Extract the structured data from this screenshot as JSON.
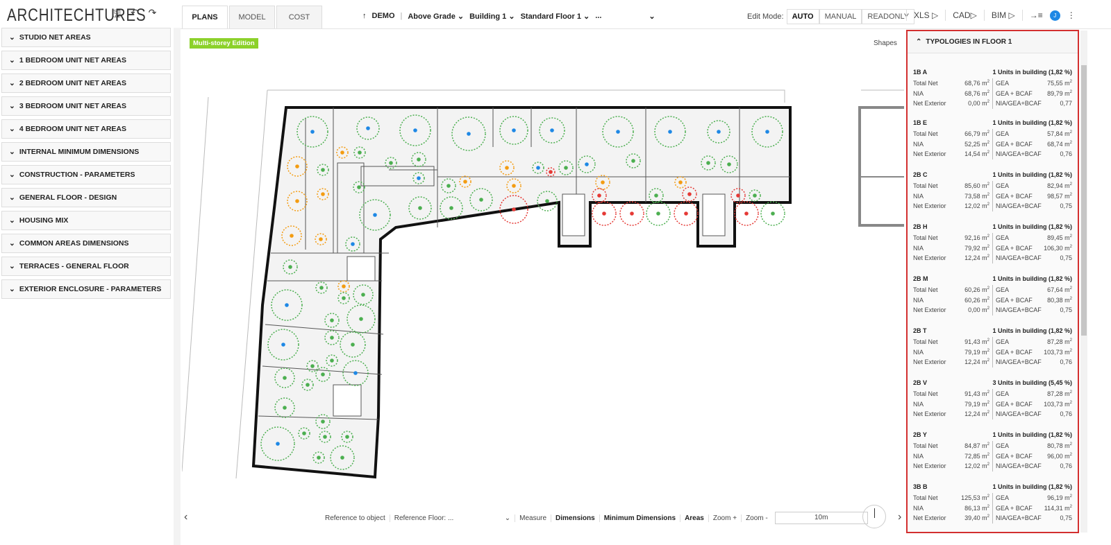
{
  "app": {
    "logo": "ARCHITECHTURES",
    "save_icon": "floppy-icon",
    "undo_icon": "undo-icon",
    "redo_icon": "redo-icon"
  },
  "tabs": [
    {
      "label": "PLANS",
      "active": true
    },
    {
      "label": "MODEL"
    },
    {
      "label": "COST"
    }
  ],
  "breadcrumb": {
    "project": "DEMO",
    "grade": "Above Grade",
    "building": "Building 1",
    "floor": "Standard Floor 1",
    "more": "..."
  },
  "edit_mode": {
    "label": "Edit Mode:",
    "options": [
      "AUTO",
      "MANUAL",
      "READONLY"
    ],
    "selected": "AUTO"
  },
  "exports": [
    "XLS ▷",
    "CAD▷",
    "BIM ▷"
  ],
  "user_initial": "J",
  "sidebar": [
    "STUDIO NET AREAS",
    "1 BEDROOM UNIT NET AREAS",
    "2 BEDROOM UNIT NET AREAS",
    "3 BEDROOM UNIT NET AREAS",
    "4 BEDROOM UNIT NET AREAS",
    "INTERNAL MINIMUM DIMENSIONS",
    "CONSTRUCTION - PARAMETERS",
    "GENERAL FLOOR - DESIGN",
    "HOUSING MIX",
    "COMMON AREAS DIMENSIONS",
    "TERRACES - GENERAL FLOOR",
    "EXTERIOR ENCLOSURE - PARAMETERS"
  ],
  "canvas": {
    "badge": "Multi-storey Edition",
    "shapes_label": "Shapes"
  },
  "panel": {
    "title": "TYPOLOGIES IN FLOOR 1",
    "labels": {
      "total_net": "Total Net",
      "nia": "NIA",
      "net_exterior": "Net Exterior",
      "gea": "GEA",
      "gea_bcaf": "GEA + BCAF",
      "ratio": "NIA/GEA+BCAF",
      "unit": "m"
    },
    "typologies": [
      {
        "name": "1B A",
        "units": "1 Units in building (1,82 %)",
        "total_net": "68,76",
        "nia": "68,76",
        "net_exterior": "0,00",
        "gea": "75,55",
        "gea_bcaf": "89,79",
        "ratio": "0,77"
      },
      {
        "name": "1B E",
        "units": "1 Units in building (1,82 %)",
        "total_net": "66,79",
        "nia": "52,25",
        "net_exterior": "14,54",
        "gea": "57,84",
        "gea_bcaf": "68,74",
        "ratio": "0,76"
      },
      {
        "name": "2B C",
        "units": "1 Units in building (1,82 %)",
        "total_net": "85,60",
        "nia": "73,58",
        "net_exterior": "12,02",
        "gea": "82,94",
        "gea_bcaf": "98,57",
        "ratio": "0,75"
      },
      {
        "name": "2B H",
        "units": "1 Units in building (1,82 %)",
        "total_net": "92,16",
        "nia": "79,92",
        "net_exterior": "12,24",
        "gea": "89,45",
        "gea_bcaf": "106,30",
        "ratio": "0,75"
      },
      {
        "name": "2B M",
        "units": "1 Units in building (1,82 %)",
        "total_net": "60,26",
        "nia": "60,26",
        "net_exterior": "0,00",
        "gea": "67,64",
        "gea_bcaf": "80,38",
        "ratio": "0,75"
      },
      {
        "name": "2B T",
        "units": "1 Units in building (1,82 %)",
        "total_net": "91,43",
        "nia": "79,19",
        "net_exterior": "12,24",
        "gea": "87,28",
        "gea_bcaf": "103,73",
        "ratio": "0,76"
      },
      {
        "name": "2B V",
        "units": "3 Units in building (5,45 %)",
        "total_net": "91,43",
        "nia": "79,19",
        "net_exterior": "12,24",
        "gea": "87,28",
        "gea_bcaf": "103,73",
        "ratio": "0,76"
      },
      {
        "name": "2B Y",
        "units": "1 Units in building (1,82 %)",
        "total_net": "84,87",
        "nia": "72,85",
        "net_exterior": "12,02",
        "gea": "80,78",
        "gea_bcaf": "96,00",
        "ratio": "0,76"
      },
      {
        "name": "3B B",
        "units": "1 Units in building (1,82 %)",
        "total_net": "125,53",
        "nia": "86,13",
        "net_exterior": "39,40",
        "gea": "96,19",
        "gea_bcaf": "114,31",
        "ratio": "0,75"
      }
    ]
  },
  "bottom": {
    "reference_object": "Reference to object",
    "reference_floor": "Reference Floor: ...",
    "measure": "Measure",
    "dimensions": "Dimensions",
    "min_dimensions": "Minimum Dimensions",
    "areas": "Areas",
    "zoom_in": "Zoom +",
    "zoom_out": "Zoom -",
    "scale": "10m"
  },
  "colors": {
    "accent_badge": "#8cd12a",
    "panel_border": "#d32f2f",
    "dot_blue": "#1e88e5",
    "dot_green": "#4caf50",
    "dot_orange": "#f39c12",
    "dot_red": "#e53935"
  }
}
